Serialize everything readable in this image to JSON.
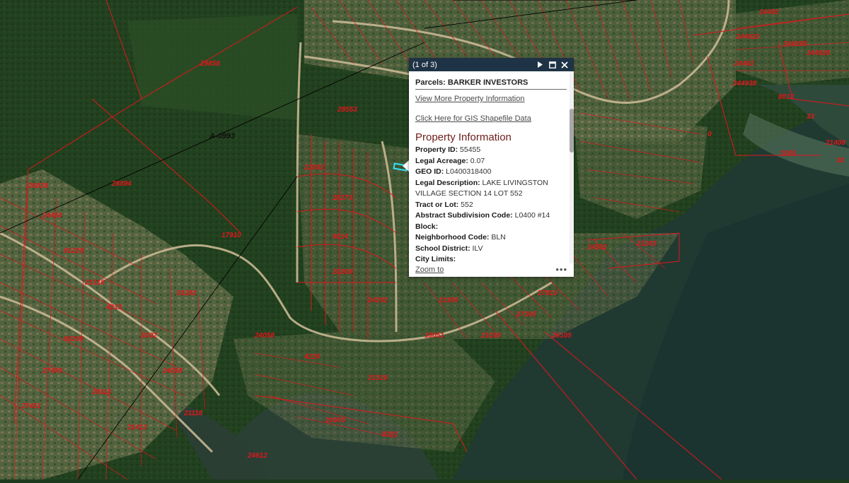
{
  "map": {
    "abstract_label": "A-0993",
    "parcel_labels": [
      "29858",
      "28553",
      "28894",
      "17910",
      "24492",
      "244932",
      "244938",
      "24492",
      "244938",
      "244928",
      "8012",
      "2005",
      "21408",
      "30",
      "26828",
      "24450",
      "81220",
      "21318",
      "4213",
      "80205",
      "27493",
      "27451",
      "20113",
      "8302",
      "81282",
      "24058",
      "21412",
      "21118",
      "33",
      "0",
      "22082",
      "28273",
      "8014",
      "20208",
      "24202",
      "21300",
      "20101",
      "27810",
      "24502",
      "21203",
      "24058",
      "4220",
      "21316",
      "20003",
      "8201",
      "18051",
      "21038",
      "27105",
      "26105",
      "24612"
    ]
  },
  "popup": {
    "count": "(1 of 3)",
    "title": "Parcels: BARKER INVESTORS",
    "link_more": "View More Property Information",
    "link_gis": "Click Here for GIS Shapefile Data",
    "section": "Property Information",
    "fields": [
      {
        "k": "Property ID:",
        "v": " 55455"
      },
      {
        "k": "Legal Acreage:",
        "v": " 0.07"
      },
      {
        "k": "GEO ID:",
        "v": " L0400318400"
      },
      {
        "k": "Legal Description:",
        "v": " LAKE LIVINGSTON VILLAGE SECTION 14 LOT 552"
      },
      {
        "k": "Tract or Lot:",
        "v": " 552"
      },
      {
        "k": "Abstract Subdivision Code:",
        "v": " L0400 #14"
      },
      {
        "k": "Block:",
        "v": ""
      },
      {
        "k": "Neighborhood Code:",
        "v": " BLN"
      },
      {
        "k": "School District:",
        "v": " ILV"
      },
      {
        "k": "City Limits:",
        "v": ""
      }
    ],
    "zoom_label": "Zoom to",
    "more_label": "•••",
    "colors": {
      "header": "#1e3346",
      "section": "#6e1d1a",
      "parcel": "#e0161b"
    }
  }
}
